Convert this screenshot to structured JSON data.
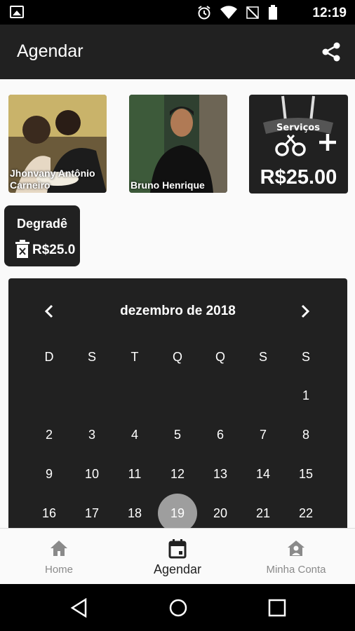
{
  "status_bar": {
    "time": "12:19",
    "icons": [
      "image-icon",
      "alarm-icon",
      "wifi-icon",
      "no-signal-icon",
      "battery-icon"
    ]
  },
  "app_bar": {
    "title": "Agendar",
    "action_icon": "share-icon"
  },
  "professionals": [
    {
      "name": "Jhonvany Antônio Carneiro"
    },
    {
      "name": "Bruno Henrique"
    }
  ],
  "services_card": {
    "badge": "Serviços",
    "price": "R$25.00"
  },
  "selected_service": {
    "name": "Degradê",
    "price": "R$25.0"
  },
  "calendar": {
    "month_label": "dezembro de 2018",
    "weekdays": [
      "D",
      "S",
      "T",
      "Q",
      "Q",
      "S",
      "S"
    ],
    "weeks": [
      [
        "",
        "",
        "",
        "",
        "",
        "",
        "1"
      ],
      [
        "2",
        "3",
        "4",
        "5",
        "6",
        "7",
        "8"
      ],
      [
        "9",
        "10",
        "11",
        "12",
        "13",
        "14",
        "15"
      ],
      [
        "16",
        "17",
        "18",
        "19",
        "20",
        "21",
        "22"
      ]
    ],
    "selected_day": "19"
  },
  "bottom_nav": [
    {
      "label": "Home",
      "icon": "home-icon",
      "active": false
    },
    {
      "label": "Agendar",
      "icon": "calendar-icon",
      "active": true
    },
    {
      "label": "Minha Conta",
      "icon": "account-icon",
      "active": false
    }
  ],
  "colors": {
    "appbar": "#212121",
    "card": "#212121",
    "selected_day": "#9e9e9e",
    "background": "#fafafa"
  }
}
